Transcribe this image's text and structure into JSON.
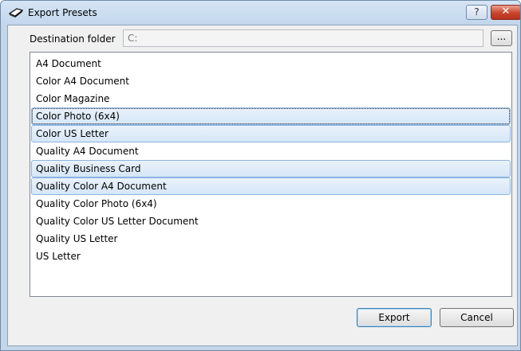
{
  "window": {
    "title": "Export Presets",
    "help_label": "?",
    "close_label": "✕",
    "icon": "scanner-icon"
  },
  "destination": {
    "label": "Destination folder",
    "value": "C:",
    "browse_label": "..."
  },
  "presets": {
    "items": [
      {
        "label": "A4 Document",
        "selected": false,
        "focused": false
      },
      {
        "label": "Color A4 Document",
        "selected": false,
        "focused": false
      },
      {
        "label": "Color Magazine",
        "selected": false,
        "focused": false
      },
      {
        "label": "Color Photo (6x4)",
        "selected": true,
        "focused": true
      },
      {
        "label": "Color US Letter",
        "selected": true,
        "focused": false
      },
      {
        "label": "Quality A4 Document",
        "selected": false,
        "focused": false
      },
      {
        "label": "Quality Business Card",
        "selected": true,
        "focused": false
      },
      {
        "label": "Quality Color A4 Document",
        "selected": true,
        "focused": false
      },
      {
        "label": "Quality Color Photo (6x4)",
        "selected": false,
        "focused": false
      },
      {
        "label": "Quality Color US Letter Document",
        "selected": false,
        "focused": false
      },
      {
        "label": "Quality US Letter",
        "selected": false,
        "focused": false
      },
      {
        "label": "US Letter",
        "selected": false,
        "focused": false
      }
    ]
  },
  "actions": {
    "export_label": "Export",
    "cancel_label": "Cancel"
  },
  "colors": {
    "selection_border": "#8bb3e0",
    "titlebar": "#c4d6ea",
    "close_button": "#c9432c"
  }
}
